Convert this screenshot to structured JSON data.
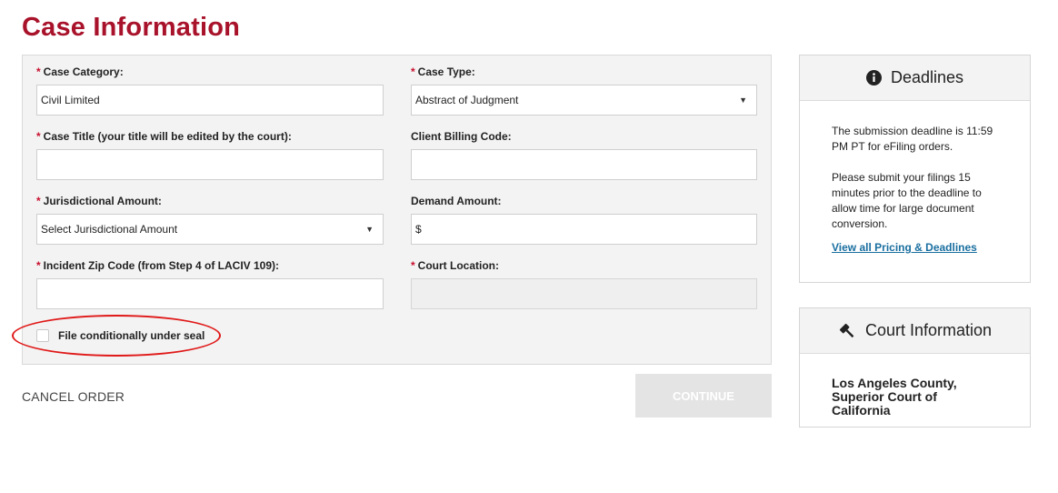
{
  "page": {
    "title": "Case Information"
  },
  "form": {
    "case_category": {
      "label": "Case Category:",
      "required": true,
      "value": "Civil Limited"
    },
    "case_type": {
      "label": "Case Type:",
      "required": true,
      "value": "Abstract of Judgment"
    },
    "case_title": {
      "label": "Case Title (your title will be edited by the court):",
      "required": true,
      "value": ""
    },
    "client_billing_code": {
      "label": "Client Billing Code:",
      "required": false,
      "value": ""
    },
    "jurisdictional_amount": {
      "label": "Jurisdictional Amount:",
      "required": true,
      "value": "Select Jurisdictional Amount"
    },
    "demand_amount": {
      "label": "Demand Amount:",
      "required": false,
      "value": "$"
    },
    "incident_zip": {
      "label": "Incident Zip Code (from Step 4 of LACIV 109):",
      "required": true,
      "value": ""
    },
    "court_location": {
      "label": "Court Location:",
      "required": true,
      "value": ""
    },
    "seal_checkbox": {
      "label": "File conditionally under seal",
      "checked": false
    },
    "required_marker": "*"
  },
  "actions": {
    "cancel_label": "CANCEL ORDER",
    "continue_label": "CONTINUE"
  },
  "deadlines": {
    "title": "Deadlines",
    "icon": "info-circle-icon",
    "paragraph1": "The submission deadline is 11:59 PM PT for eFiling orders.",
    "paragraph2": "Please submit your filings 15 minutes prior to the deadline to allow time for large document conversion.",
    "link_label": "View all Pricing & Deadlines"
  },
  "court_info": {
    "title": "Court Information",
    "icon": "gavel-icon",
    "court_name": "Los Angeles County, Superior Court of California"
  },
  "colors": {
    "brand": "#a8122a",
    "required": "#c8102e",
    "link": "#1a6fa0",
    "annotation": "#e01818"
  }
}
